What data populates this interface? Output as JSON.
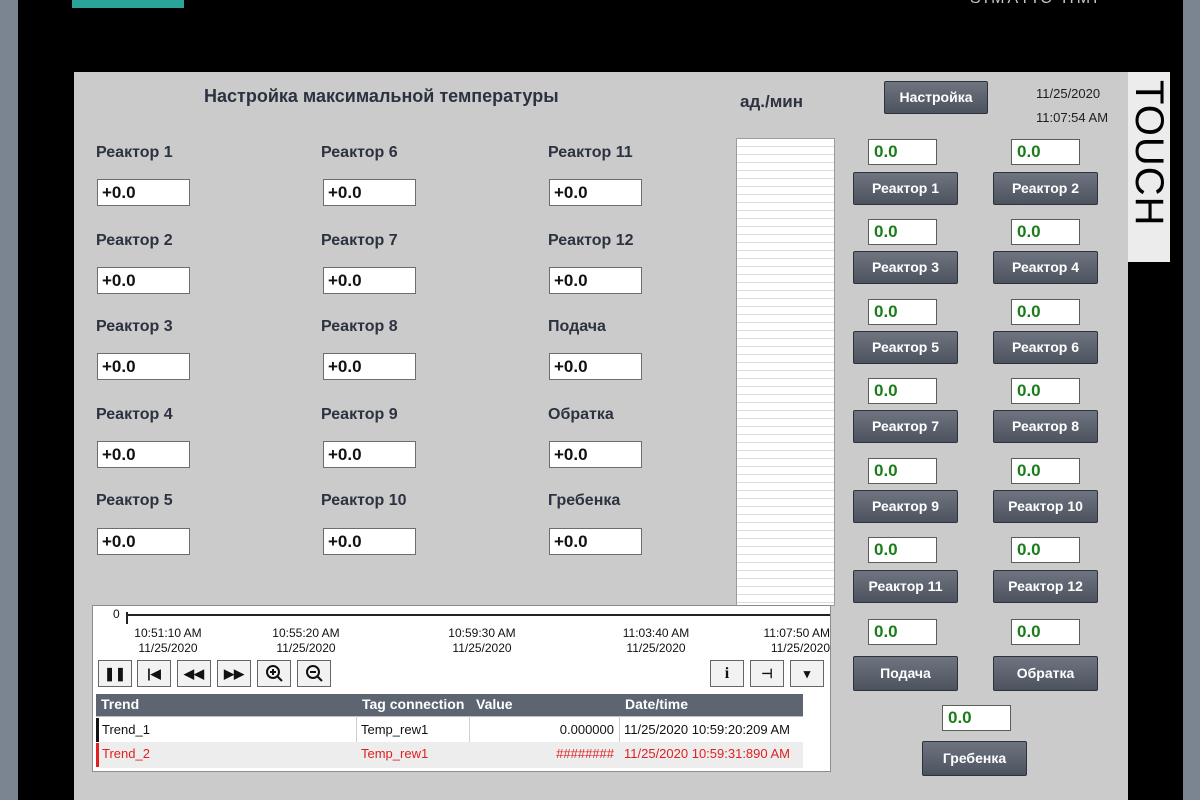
{
  "bezel": {
    "brand": "SIMATIC HMI",
    "touch_label": "TOUCH"
  },
  "header": {
    "title": "Настройка максимальной температуры",
    "units": "ад./мин",
    "settings_button": "Настройка",
    "date": "11/25/2020",
    "time": "11:07:54 AM"
  },
  "setpoints": [
    {
      "label": "Реактор 1",
      "value": "+0.0"
    },
    {
      "label": "Реактор 2",
      "value": "+0.0"
    },
    {
      "label": "Реактор 3",
      "value": "+0.0"
    },
    {
      "label": "Реактор 4",
      "value": "+0.0"
    },
    {
      "label": "Реактор 5",
      "value": "+0.0"
    },
    {
      "label": "Реактор 6",
      "value": "+0.0"
    },
    {
      "label": "Реактор 7",
      "value": "+0.0"
    },
    {
      "label": "Реактор 8",
      "value": "+0.0"
    },
    {
      "label": "Реактор 9",
      "value": "+0.0"
    },
    {
      "label": "Реактор 10",
      "value": "+0.0"
    },
    {
      "label": "Реактор 11",
      "value": "+0.0"
    },
    {
      "label": "Реактор 12",
      "value": "+0.0"
    },
    {
      "label": "Подача",
      "value": "+0.0"
    },
    {
      "label": "Обратка",
      "value": "+0.0"
    },
    {
      "label": "Гребенка",
      "value": "+0.0"
    }
  ],
  "channels": [
    {
      "label": "Реактор 1",
      "value": "0.0"
    },
    {
      "label": "Реактор 2",
      "value": "0.0"
    },
    {
      "label": "Реактор 3",
      "value": "0.0"
    },
    {
      "label": "Реактор 4",
      "value": "0.0"
    },
    {
      "label": "Реактор 5",
      "value": "0.0"
    },
    {
      "label": "Реактор 6",
      "value": "0.0"
    },
    {
      "label": "Реактор 7",
      "value": "0.0"
    },
    {
      "label": "Реактор 8",
      "value": "0.0"
    },
    {
      "label": "Реактор 9",
      "value": "0.0"
    },
    {
      "label": "Реактор 10",
      "value": "0.0"
    },
    {
      "label": "Реактор 11",
      "value": "0.0"
    },
    {
      "label": "Реактор 12",
      "value": "0.0"
    },
    {
      "label": "Подача",
      "value": "0.0"
    },
    {
      "label": "Обратка",
      "value": "0.0"
    },
    {
      "label": "Гребенка",
      "value": "0.0"
    }
  ],
  "trend_view": {
    "y_zero": "0",
    "ticks": [
      {
        "time": "10:51:10 AM",
        "date": "11/25/2020"
      },
      {
        "time": "10:55:20 AM",
        "date": "11/25/2020"
      },
      {
        "time": "10:59:30 AM",
        "date": "11/25/2020"
      },
      {
        "time": "11:03:40 AM",
        "date": "11/25/2020"
      },
      {
        "time": "11:07:50 AM",
        "date": "11/25/2020"
      }
    ],
    "toolbar_icons": [
      "pause-icon",
      "first-page-icon",
      "rewind-icon",
      "forward-icon",
      "zoom-in-icon",
      "zoom-out-icon",
      "info-icon",
      "ruler-icon",
      "menu-icon"
    ],
    "columns": [
      "Trend",
      "Tag connection",
      "Value",
      "Date/time"
    ],
    "rows": [
      {
        "trend": "Trend_1",
        "tag": "Temp_rew1",
        "value": "0.000000",
        "datetime": "11/25/2020 10:59:20:209 AM",
        "color": "#111111"
      },
      {
        "trend": "Trend_2",
        "tag": "Temp_rew1",
        "value": "########",
        "datetime": "11/25/2020 10:59:31:890 AM",
        "color": "#e02020"
      }
    ]
  },
  "colors": {
    "panel": "#cbcbcb",
    "button": "#575d68",
    "value_green": "#1a7d1a",
    "bezel": "#7b8591"
  }
}
